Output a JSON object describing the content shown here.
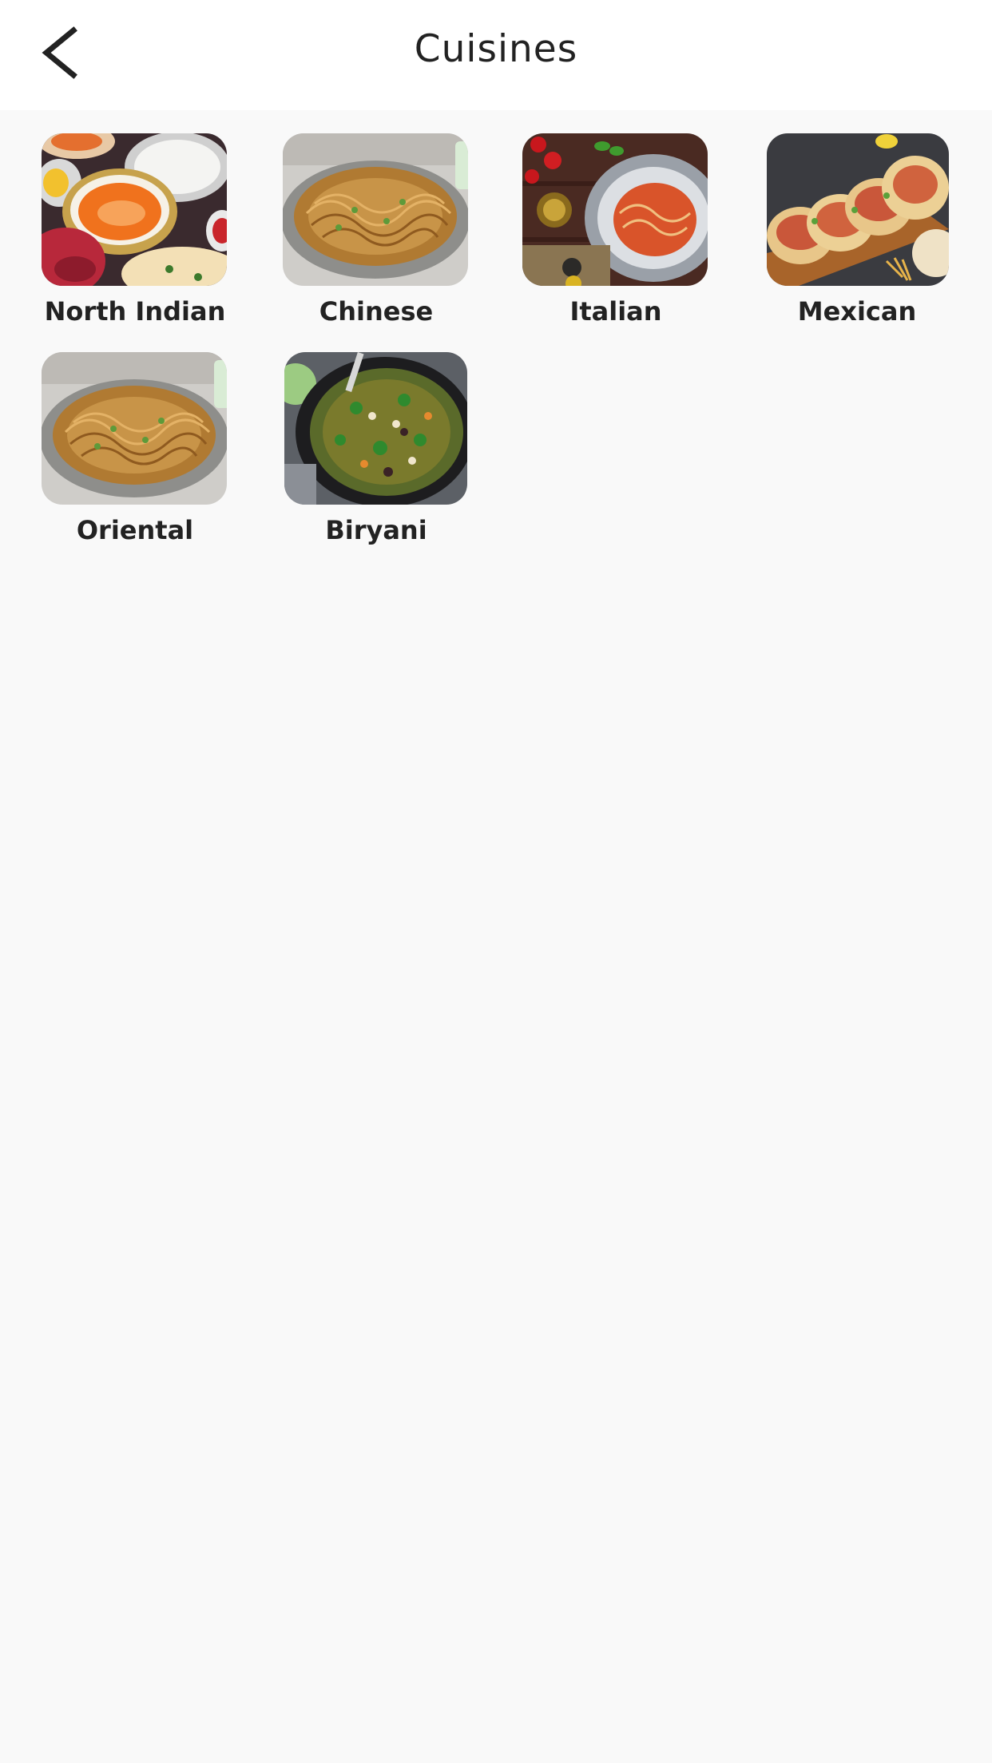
{
  "header": {
    "title": "Cuisines",
    "back_icon": "chevron-left-icon"
  },
  "cuisines": [
    {
      "label": "North Indian",
      "image": "north-indian-dishes"
    },
    {
      "label": "Chinese",
      "image": "noodles-bowl"
    },
    {
      "label": "Italian",
      "image": "spaghetti-plate"
    },
    {
      "label": "Mexican",
      "image": "tacos-board"
    },
    {
      "label": "Oriental",
      "image": "noodles-bowl"
    },
    {
      "label": "Biryani",
      "image": "biryani-pan"
    }
  ],
  "colors": {
    "background": "#f9f9f9",
    "appbar": "#ffffff",
    "text": "#222222"
  }
}
